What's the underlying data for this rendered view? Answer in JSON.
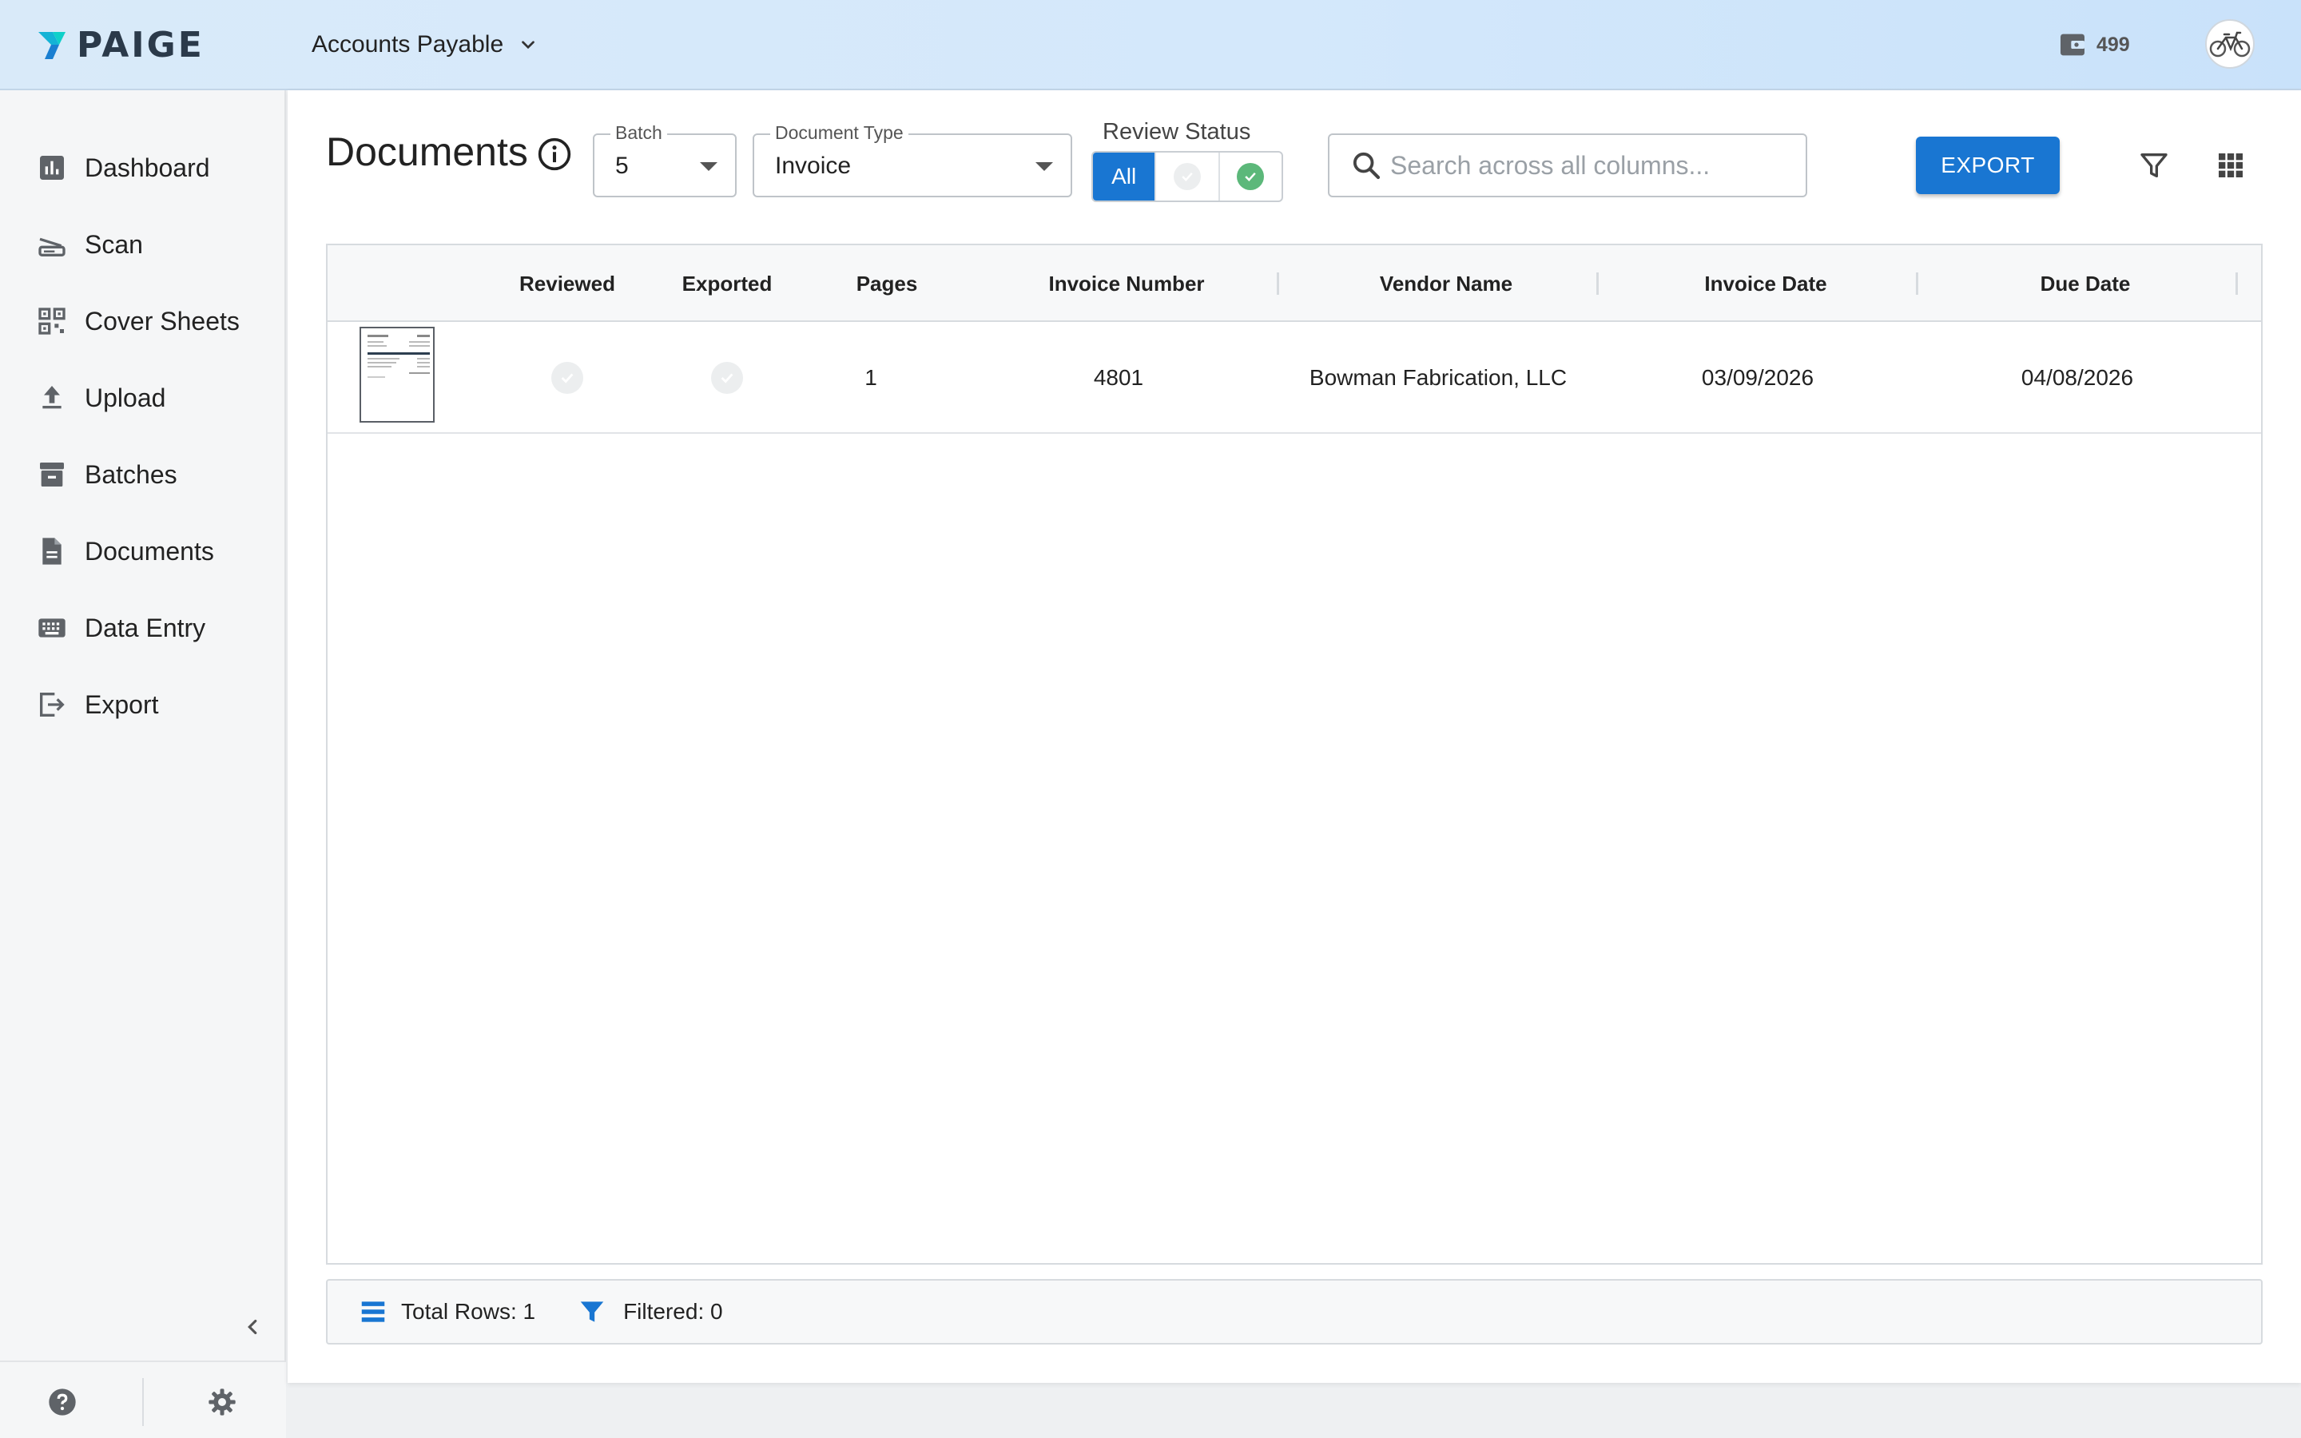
{
  "app": {
    "brand": "PAIGE",
    "workspace": "Accounts Payable",
    "credits": "499"
  },
  "sidebar": {
    "items": [
      {
        "label": "Dashboard",
        "icon": "bar-chart-icon"
      },
      {
        "label": "Scan",
        "icon": "scanner-icon"
      },
      {
        "label": "Cover Sheets",
        "icon": "qr-code-icon"
      },
      {
        "label": "Upload",
        "icon": "upload-icon"
      },
      {
        "label": "Batches",
        "icon": "archive-box-icon"
      },
      {
        "label": "Documents",
        "icon": "document-icon"
      },
      {
        "label": "Data Entry",
        "icon": "keyboard-icon"
      },
      {
        "label": "Export",
        "icon": "export-icon"
      }
    ]
  },
  "page": {
    "title": "Documents"
  },
  "filters": {
    "batch": {
      "label": "Batch",
      "value": "5"
    },
    "document_type": {
      "label": "Document Type",
      "value": "Invoice"
    },
    "review_status": {
      "label": "Review Status",
      "options": [
        "All",
        "unreviewed",
        "reviewed"
      ],
      "selected": "All"
    },
    "search": {
      "placeholder": "Search across all columns..."
    },
    "export_label": "EXPORT"
  },
  "table": {
    "columns": [
      "",
      "Reviewed",
      "Exported",
      "Pages",
      "Invoice Number",
      "Vendor Name",
      "Invoice Date",
      "Due Date"
    ],
    "rows": [
      {
        "reviewed": false,
        "exported": false,
        "pages": "1",
        "invoice_number": "4801",
        "vendor_name": "Bowman Fabrication, LLC",
        "invoice_date": "03/09/2026",
        "due_date": "04/08/2026"
      }
    ]
  },
  "footer": {
    "total_rows": "Total Rows: 1",
    "filtered": "Filtered: 0"
  },
  "colors": {
    "accent": "#1976d2",
    "reviewed_green": "#5cb87a",
    "topbar": "#d4e8fb"
  }
}
